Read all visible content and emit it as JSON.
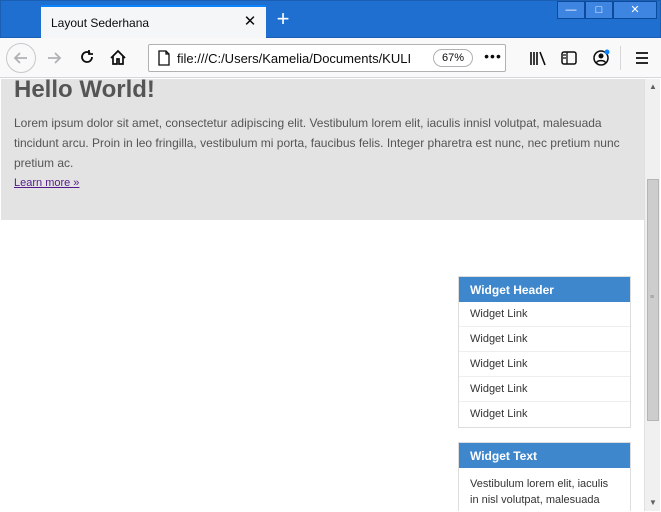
{
  "browser": {
    "tab_title": "Layout Sederhana",
    "tab_close": "✕",
    "new_tab": "+",
    "window_controls": {
      "minimize": "—",
      "maximize": "□",
      "close": "✕"
    },
    "url": "file:///C:/Users/Kamelia/Documents/KULI",
    "zoom": "67%",
    "more": "•••"
  },
  "page": {
    "jumbotron": {
      "title": "Hello World!",
      "text": "Lorem ipsum dolor sit amet, consectetur adipiscing elit. Vestibulum lorem elit, iaculis innisl volutpat, malesuada tincidunt arcu. Proin in leo fringilla, vestibulum mi porta, faucibus felis. Integer pharetra est nunc, nec pretium nunc pretium ac.",
      "link": "Learn more »"
    },
    "widget_links": {
      "header": "Widget Header",
      "items": [
        "Widget Link",
        "Widget Link",
        "Widget Link",
        "Widget Link",
        "Widget Link"
      ]
    },
    "widget_text": {
      "header": "Widget Text",
      "body": "Vestibulum lorem elit, iaculis in nisl volutpat, malesuada"
    }
  },
  "colors": {
    "titlebar": "#1e6fd0",
    "widget_header": "#3e87cc",
    "jumbotron_bg": "#e3e3e3",
    "link_visited": "#551a8b"
  }
}
